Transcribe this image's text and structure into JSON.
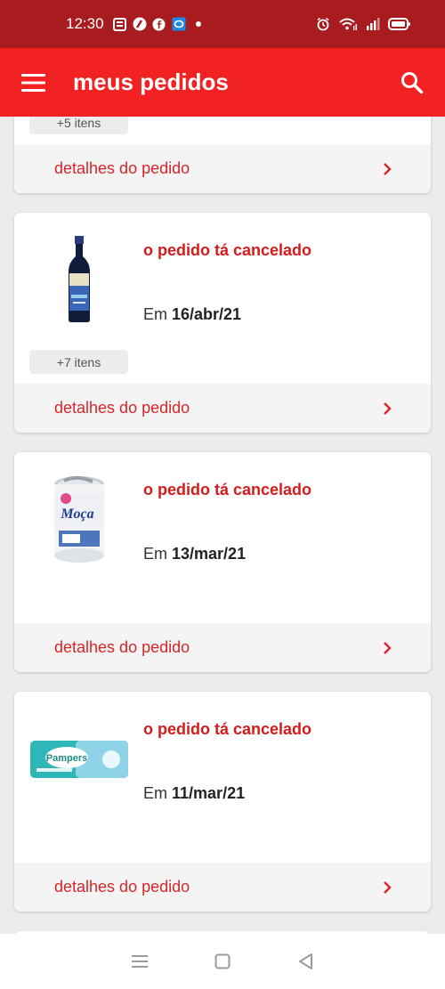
{
  "status_bar": {
    "time": "12:30",
    "icons_left": [
      "news-icon",
      "sports-icon",
      "facebook-icon",
      "chat-icon",
      "dot-icon"
    ],
    "icons_right": [
      "alarm-icon",
      "wifi-icon",
      "signal-icon",
      "battery-icon"
    ]
  },
  "app_bar": {
    "title": "meus pedidos",
    "menu_icon": "hamburger-icon",
    "search_icon": "search-icon"
  },
  "orders": [
    {
      "more_items": "+5 itens",
      "details_label": "detalhes do pedido"
    },
    {
      "status": "o pedido tá cancelado",
      "date_prefix": "Em",
      "date": "16/abr/21",
      "more_items": "+7 itens",
      "details_label": "detalhes do pedido",
      "product_image": "olive-oil-bottle"
    },
    {
      "status": "o pedido tá cancelado",
      "date_prefix": "Em",
      "date": "13/mar/21",
      "details_label": "detalhes do pedido",
      "product_image": "condensed-milk-can",
      "product_brand": "Moça"
    },
    {
      "status": "o pedido tá cancelado",
      "date_prefix": "Em",
      "date": "11/mar/21",
      "details_label": "detalhes do pedido",
      "product_image": "wet-wipes-pack",
      "product_brand": "Pampers"
    }
  ],
  "nav_bar": {
    "icons": [
      "recents-icon",
      "home-icon",
      "back-icon"
    ]
  },
  "colors": {
    "status_bar": "#a81b1e",
    "app_bar": "#f22222",
    "accent_red": "#d51b1b",
    "background": "#ececec"
  }
}
